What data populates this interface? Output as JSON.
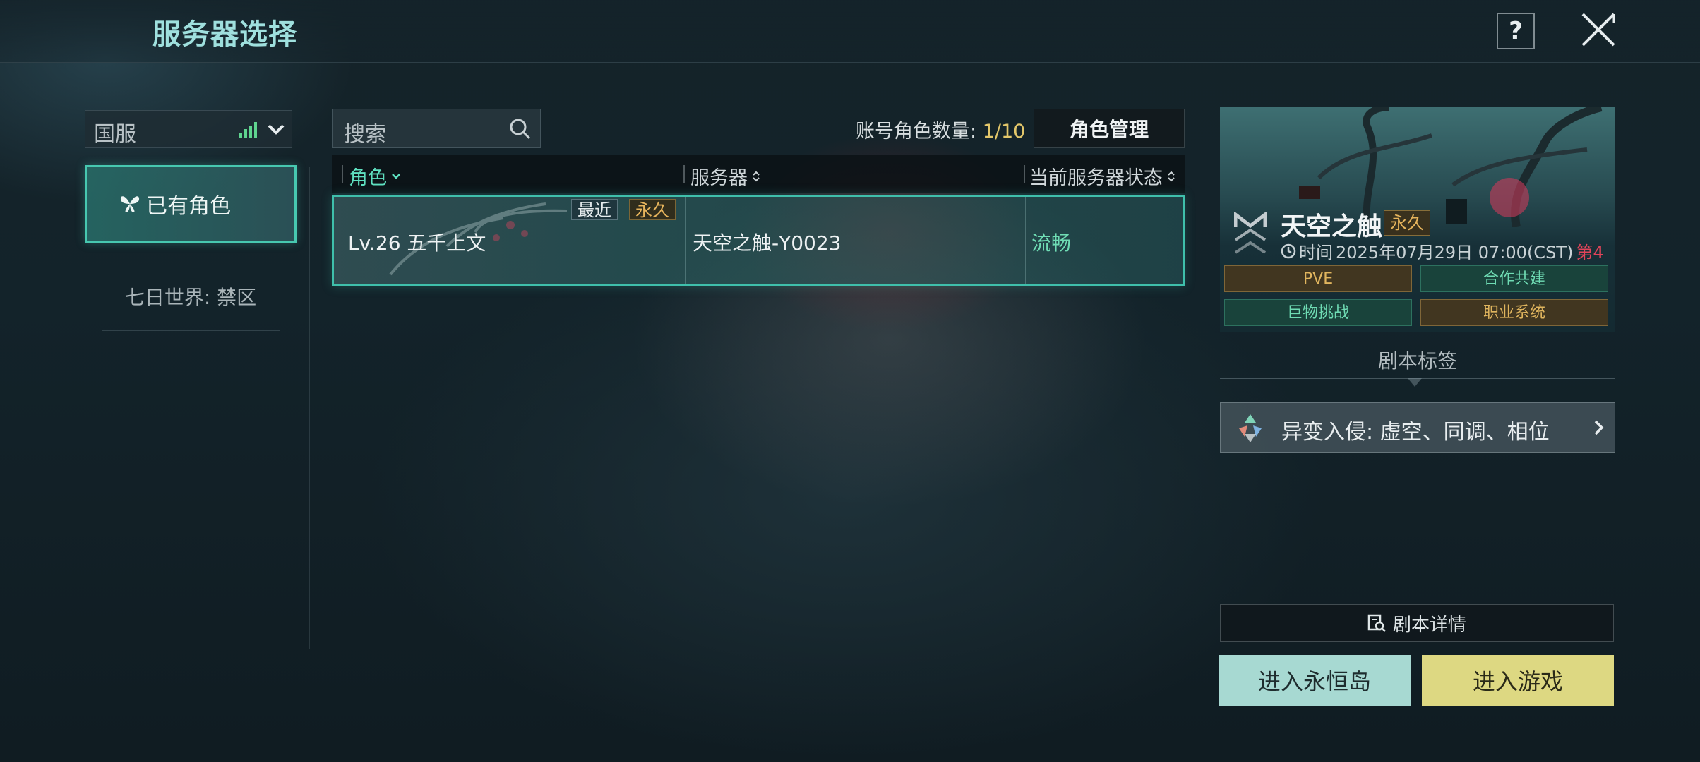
{
  "header": {
    "title": "服务器选择",
    "help_label": "?"
  },
  "colors": {
    "accent": "#47c8b0",
    "gold": "#e2c66a",
    "status_ok": "#6fdcb4",
    "enter_island_bg": "#a7d9d2",
    "enter_game_bg": "#ddd882"
  },
  "sidebar": {
    "region_value": "国服",
    "items": [
      {
        "label": "已有角色",
        "selected": true
      },
      {
        "label": "七日世界: 禁区",
        "selected": false
      }
    ]
  },
  "search": {
    "placeholder": "搜索"
  },
  "account": {
    "count_label": "账号角色数量:",
    "count_value": "1/10",
    "manage_label": "角色管理"
  },
  "table": {
    "headers": [
      "角色",
      "服务器",
      "当前服务器状态"
    ],
    "rows": [
      {
        "character": "Lv.26 五千上文",
        "tag_recent": "最近",
        "tag_permanent": "永久",
        "server": "天空之触-Y0023",
        "status": "流畅"
      }
    ]
  },
  "server_card": {
    "name": "天空之触",
    "permanence": "永久",
    "time_label": "时间",
    "time_value": "2025年07月29日 07:00(CST)",
    "time_suffix": "第4",
    "chips": [
      "PVE",
      "合作共建",
      "巨物挑战",
      "职业系统"
    ]
  },
  "script_tags": {
    "label": "剧本标签",
    "item": "异变入侵: 虚空、同调、相位"
  },
  "actions": {
    "details": "剧本详情",
    "enter_island": "进入永恒岛",
    "enter_game": "进入游戏"
  }
}
